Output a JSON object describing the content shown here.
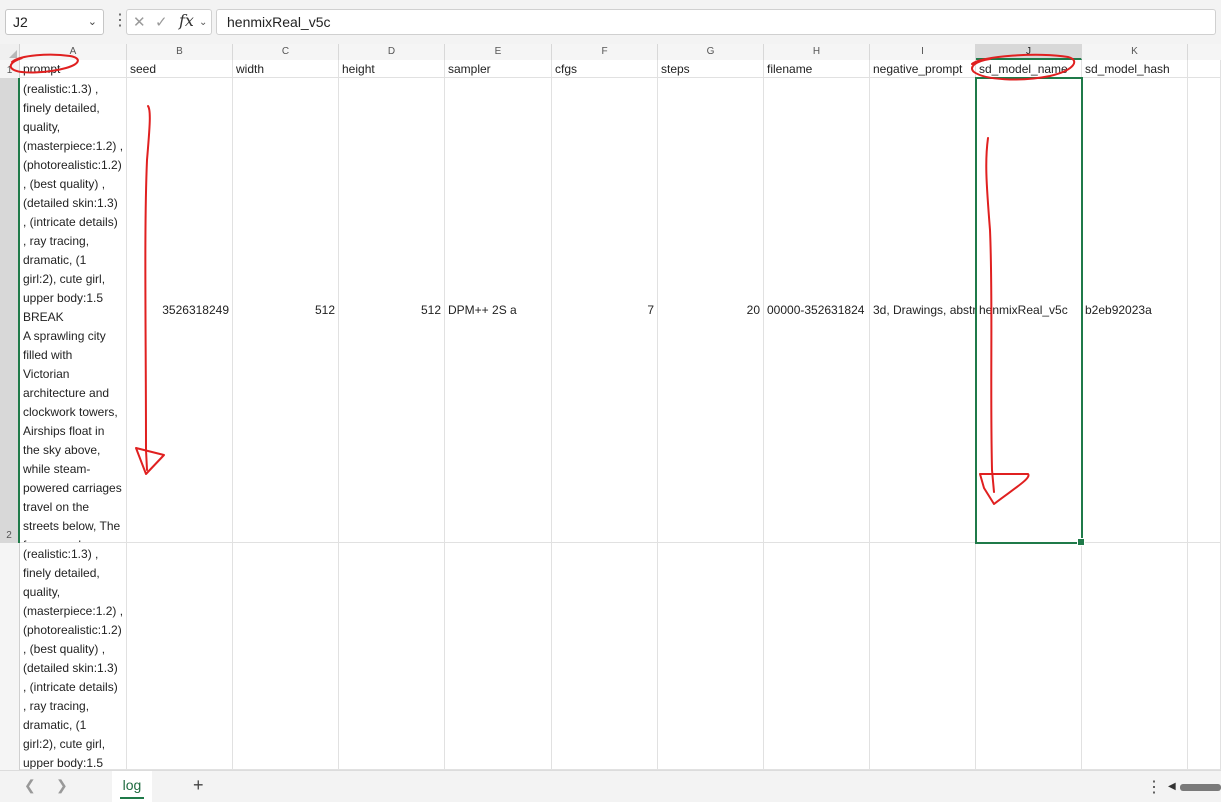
{
  "formula_bar": {
    "name_box": "J2",
    "formula": "henmixReal_v5c"
  },
  "columns": [
    {
      "letter": "A",
      "header": "prompt"
    },
    {
      "letter": "B",
      "header": "seed"
    },
    {
      "letter": "C",
      "header": "width"
    },
    {
      "letter": "D",
      "header": "height"
    },
    {
      "letter": "E",
      "header": "sampler"
    },
    {
      "letter": "F",
      "header": "cfgs"
    },
    {
      "letter": "G",
      "header": "steps"
    },
    {
      "letter": "H",
      "header": "filename"
    },
    {
      "letter": "I",
      "header": "negative_prompt"
    },
    {
      "letter": "J",
      "header": "sd_model_name"
    },
    {
      "letter": "K",
      "header": "sd_model_hash"
    }
  ],
  "row_numbers": [
    "1",
    "2"
  ],
  "row2": {
    "seed": "3526318249",
    "width": "512",
    "height": "512",
    "sampler": "DPM++ 2S a",
    "cfgs": "7",
    "steps": "20",
    "filename": "00000-352631824",
    "negative_prompt": "3d, Drawings, abstr",
    "sd_model_name": "henmixReal_v5c",
    "sd_model_hash": "b2eb92023a",
    "prompt_lines": [
      "(realistic:1.3) ,",
      "finely detailed,",
      "quality,",
      "(masterpiece:1.2) ,",
      "(photorealistic:1.2)",
      ", (best quality) ,",
      "(detailed skin:1.3)",
      ", (intricate details)",
      ", ray tracing,",
      "dramatic, (1",
      "girl:2), cute girl,",
      "upper body:1.5",
      "BREAK",
      "A sprawling city",
      "filled with",
      "Victorian",
      "architecture and",
      "clockwork towers,",
      "Airships float in",
      "the sky above,",
      "while steam-",
      "powered carriages",
      "travel on the",
      "streets below, The",
      "foreground"
    ]
  },
  "row3": {
    "prompt_lines": [
      "(realistic:1.3) ,",
      "finely detailed,",
      "quality,",
      "(masterpiece:1.2) ,",
      "(photorealistic:1.2)",
      ", (best quality) ,",
      "(detailed skin:1.3)",
      ", (intricate details)",
      ", ray tracing,",
      "dramatic, (1",
      "girl:2), cute girl,",
      "upper body:1.5"
    ]
  },
  "sheet_bar": {
    "tab": "log",
    "add": "+"
  },
  "colors": {
    "selection": "#1f7a49",
    "annotation": "#e02020"
  }
}
